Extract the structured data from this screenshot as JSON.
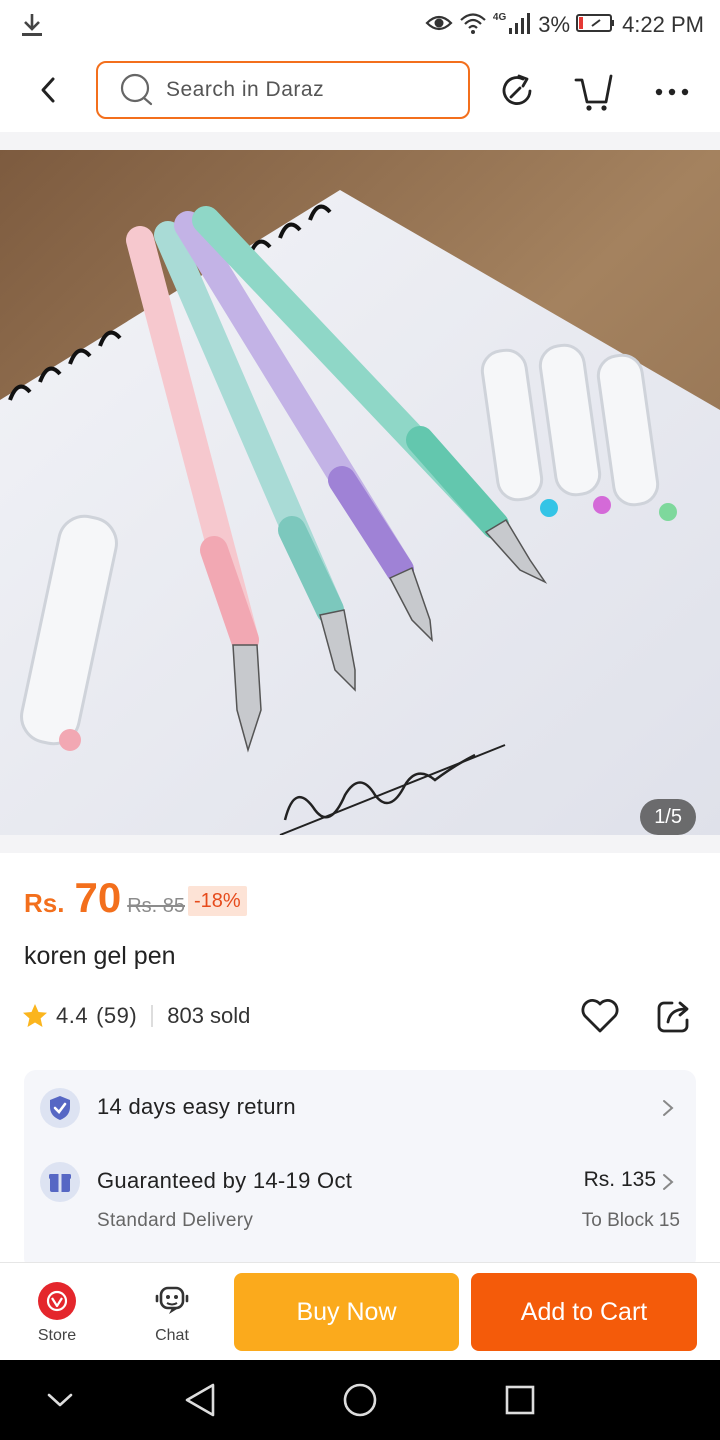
{
  "status_bar": {
    "network": "4G",
    "battery": "3%",
    "time": "4:22 PM",
    "icons": [
      "download-icon",
      "eye-icon",
      "wifi-icon",
      "signal-icon",
      "battery-icon"
    ]
  },
  "header": {
    "search_placeholder": "Search in Daraz",
    "icons": [
      "back-arrow-icon",
      "search-icon",
      "refresh-share-icon",
      "cart-icon",
      "more-icon"
    ]
  },
  "gallery": {
    "counter": "1/5",
    "current": 1,
    "total": 5
  },
  "product": {
    "currency": "Rs.",
    "price": "70",
    "original_price": "Rs. 85",
    "discount": "-18%",
    "title": "koren gel pen",
    "rating": "4.4",
    "reviews": "(59)",
    "sold": "803 sold"
  },
  "services": {
    "return": {
      "text": "14 days easy return"
    },
    "delivery": {
      "main": "Guaranteed by 14-19 Oct",
      "sub": "Standard Delivery",
      "price": "Rs. 135",
      "location": "To Block 15"
    }
  },
  "actions": {
    "store_label": "Store",
    "chat_label": "Chat",
    "buy_now": "Buy Now",
    "add_to_cart": "Add to Cart"
  },
  "colors": {
    "accent": "#f36f1c",
    "buy_now": "#fbaa1c",
    "add_to_cart": "#f45b0a",
    "discount_bg": "#fde3d6"
  }
}
